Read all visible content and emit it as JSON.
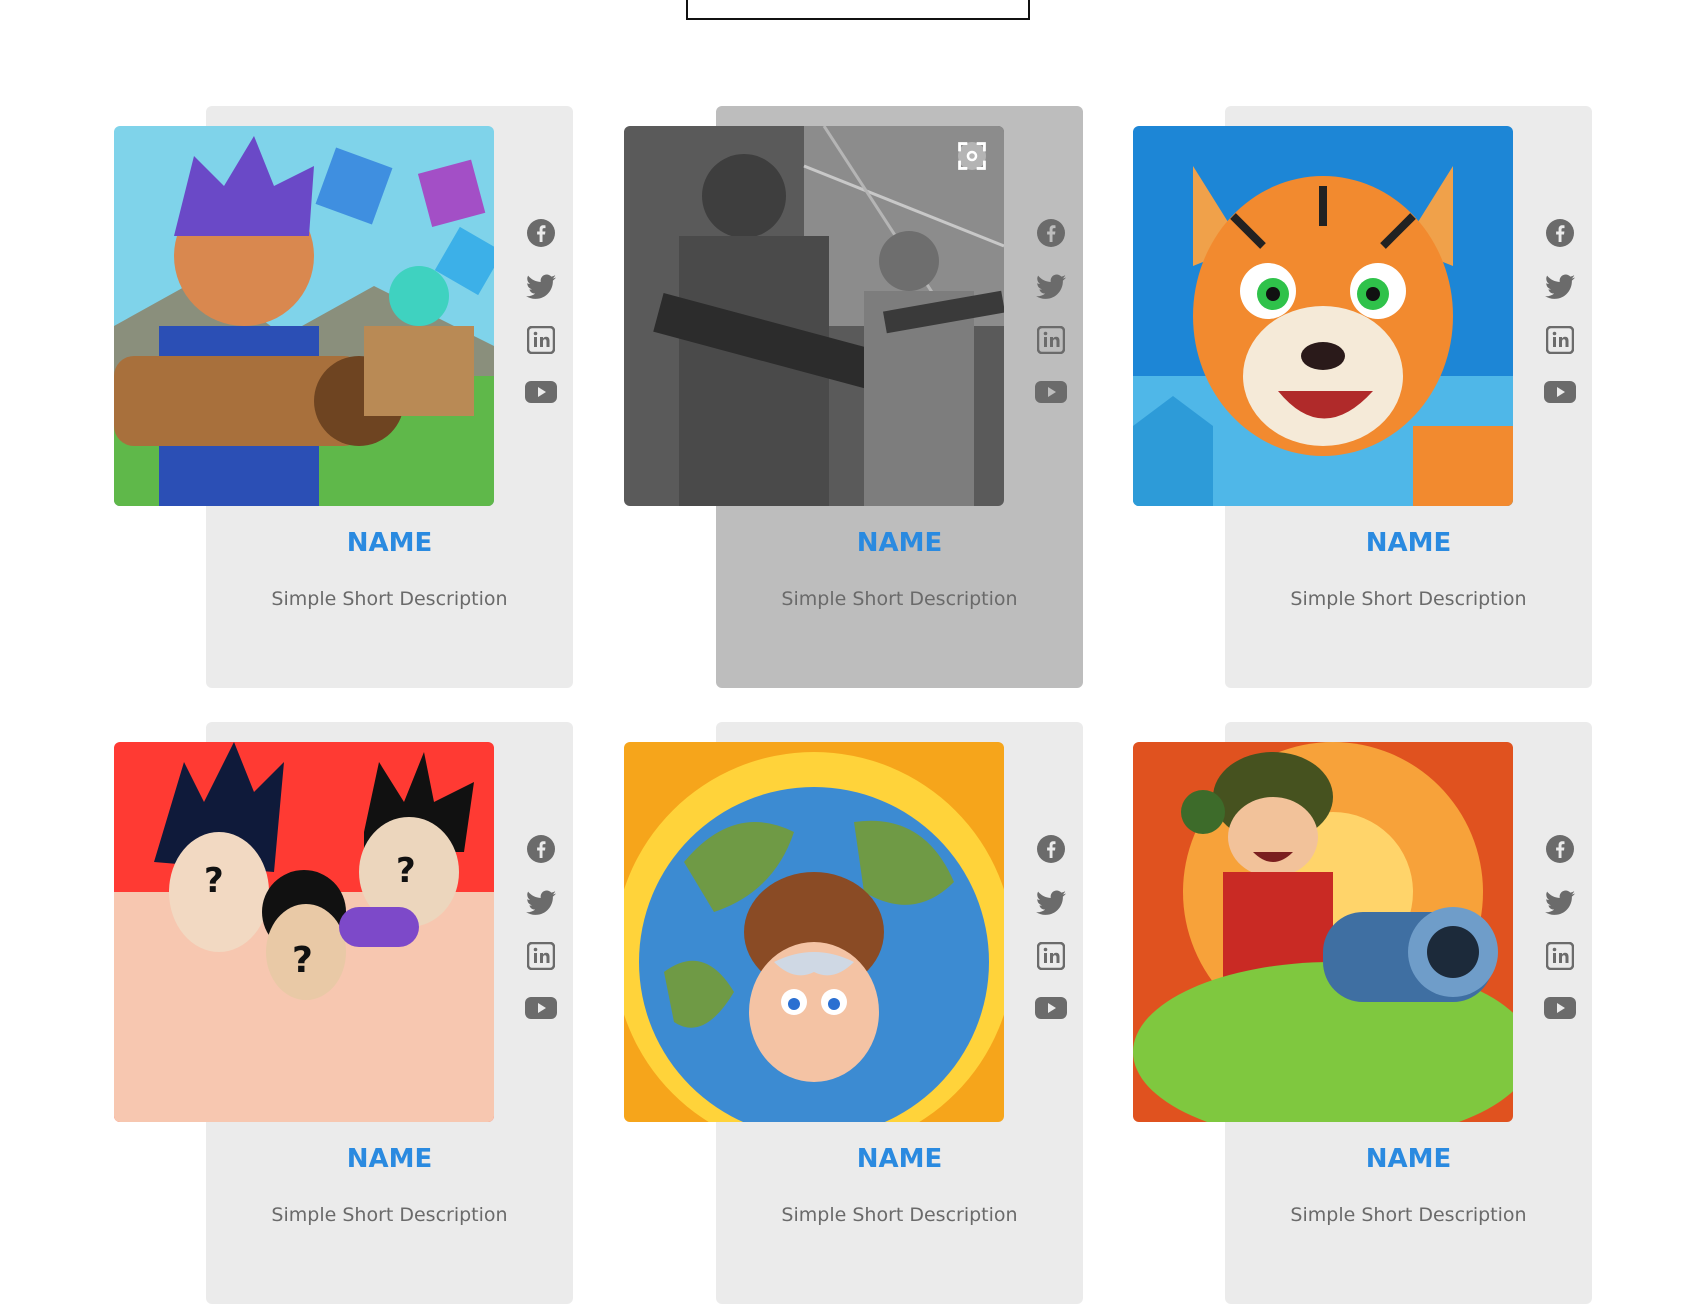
{
  "cards": [
    {
      "name": "NAME",
      "description": "Simple Short Description",
      "image": "game-hero-cannon-art"
    },
    {
      "name": "NAME",
      "description": "Simple Short Description",
      "image": "soldiers-grayscale-art"
    },
    {
      "name": "NAME",
      "description": "Simple Short Description",
      "image": "tiger-cartoon-art"
    },
    {
      "name": "NAME",
      "description": "Simple Short Description",
      "image": "mystery-characters-art"
    },
    {
      "name": "NAME",
      "description": "Simple Short Description",
      "image": "earth-cartoon-art"
    },
    {
      "name": "NAME",
      "description": "Simple Short Description",
      "image": "tank-soldier-art"
    }
  ],
  "social_icons": [
    "facebook-icon",
    "twitter-icon",
    "linkedin-icon",
    "youtube-icon"
  ],
  "colors": {
    "name_text": "#2a8ae0",
    "card_bg": "#ebebeb",
    "card_bg_active": "#bdbdbd",
    "icon_gray": "#6b6b6b",
    "description_text": "#6a6a6a"
  }
}
